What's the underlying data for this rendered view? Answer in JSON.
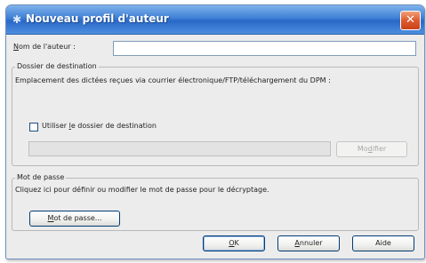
{
  "window": {
    "title": "Nouveau profil d'auteur",
    "close_label": "✕"
  },
  "author": {
    "label_first": "N",
    "label_rest": "om de l'auteur :",
    "value": ""
  },
  "destination": {
    "group_title": "Dossier de destination",
    "description": "Emplacement des dictées reçues via courrier électronique/FTP/téléchargement du DPM :",
    "checkbox_pre": "Utiliser ",
    "checkbox_u": "l",
    "checkbox_post": "e dossier de destination",
    "checkbox_checked": false,
    "path_value": "",
    "modify_pre": "Mo",
    "modify_u": "d",
    "modify_post": "ifier"
  },
  "password": {
    "group_title": "Mot de passe",
    "description": "Cliquez ici pour définir ou modifier le mot de passe pour le décryptage.",
    "button_u": "M",
    "button_rest": "ot de passe..."
  },
  "footer": {
    "ok_u": "O",
    "ok_rest": "K",
    "cancel_u": "A",
    "cancel_rest": "nnuler",
    "help_label": "Aide"
  },
  "colors": {
    "title_bar": "#3f7fd5",
    "close_button": "#dd5b2e",
    "dialog_bg": "#ececec"
  }
}
